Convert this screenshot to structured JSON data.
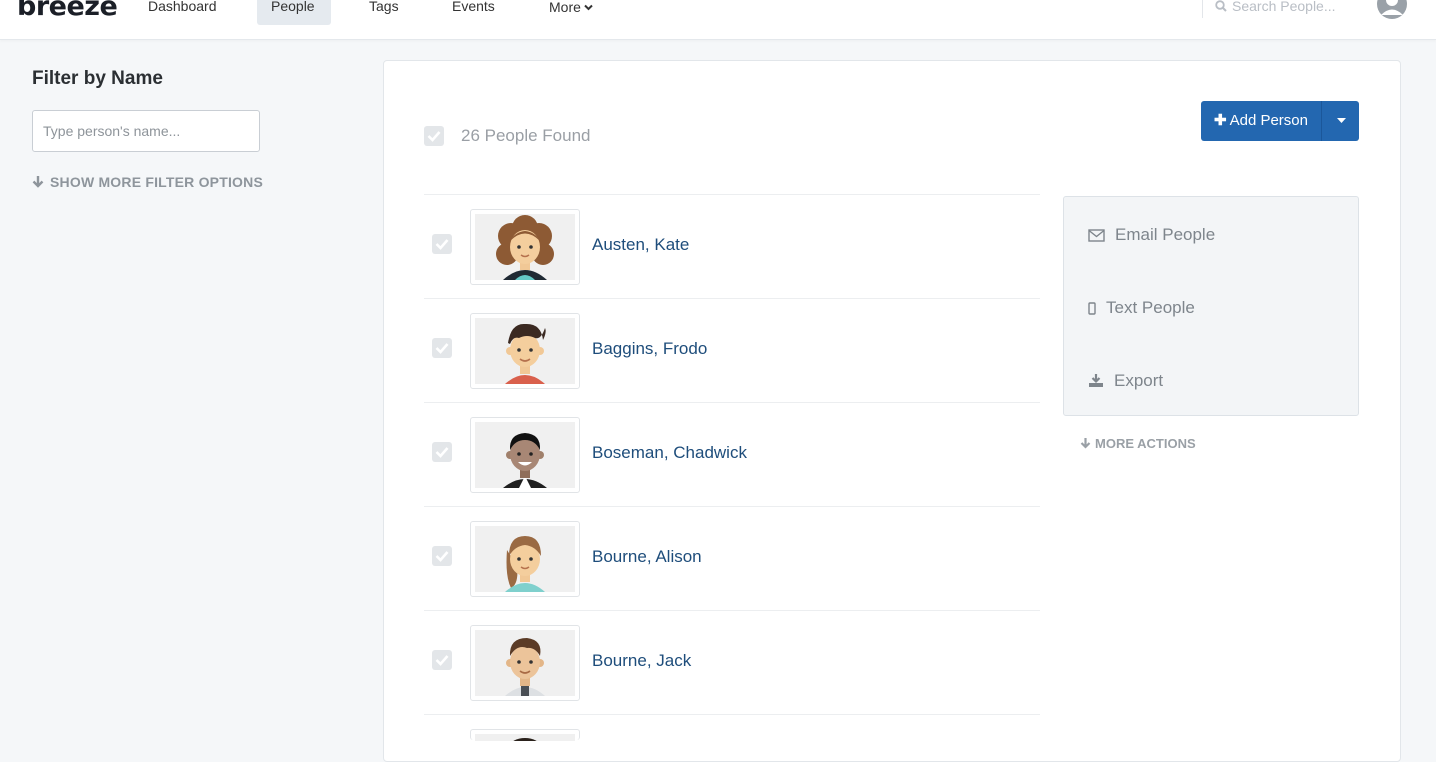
{
  "app": {
    "logo_text": "breeze",
    "nav": [
      "Dashboard",
      "People",
      "Tags",
      "Events",
      "More"
    ],
    "active_nav": "People",
    "search_placeholder": "Search People..."
  },
  "filter": {
    "title": "Filter by Name",
    "input_placeholder": "Type person's name...",
    "more_options_label": "SHOW MORE FILTER OPTIONS"
  },
  "people_list": {
    "count_label": "26 People Found",
    "add_button_label": "Add Person",
    "people": [
      {
        "name": "Austen, Kate"
      },
      {
        "name": "Baggins, Frodo"
      },
      {
        "name": "Boseman, Chadwick"
      },
      {
        "name": "Bourne, Alison"
      },
      {
        "name": "Bourne, Jack"
      }
    ]
  },
  "actions": {
    "items": [
      "Email People",
      "Text People",
      "Export"
    ],
    "icons": [
      "envelope-icon",
      "phone-icon",
      "download-icon"
    ],
    "more_label": "MORE ACTIONS"
  },
  "colors": {
    "primary_button": "#2367b0",
    "name_link": "#1e4d7b",
    "page_background": "#f5f7f9"
  }
}
